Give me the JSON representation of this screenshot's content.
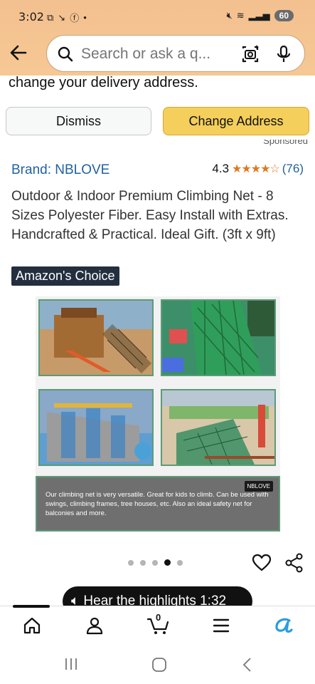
{
  "status_bar": {
    "time": "3:02",
    "battery": "60"
  },
  "search": {
    "placeholder": "Search or ask a q..."
  },
  "delivery_notice": {
    "text": "change your delivery address.",
    "dismiss_label": "Dismiss",
    "change_label": "Change Address"
  },
  "sponsored_label": "Sponsored",
  "product": {
    "brand": "Brand: NBLOVE",
    "rating": "4.3",
    "stars": "★★★★☆",
    "review_count": "(76)",
    "title": "Outdoor & Indoor Premium Climbing Net - 8 Sizes Polyester Fiber. Easy Install with Extras. Handcrafted & Practical. Ideal Gift. (3ft x 9ft)",
    "badge": "Amazon's Choice"
  },
  "gallery": {
    "brand_tag": "NBLOVE",
    "caption": "Our climbing net is very versatile. Great for kids to climb. Can be used with swings, climbing frames, tree houses, etc. Also an ideal safety net for balconies and more.",
    "dots_total": 5,
    "dots_active": 4
  },
  "highlights_label": "Hear the highlights 1:32",
  "bottom_nav": {
    "cart_count": "0"
  },
  "colors": {
    "header_bg": "#f5c590",
    "change_button": "#f5cf5b",
    "link": "#2162a1",
    "star": "#de7921",
    "badge_bg": "#232f3e"
  }
}
